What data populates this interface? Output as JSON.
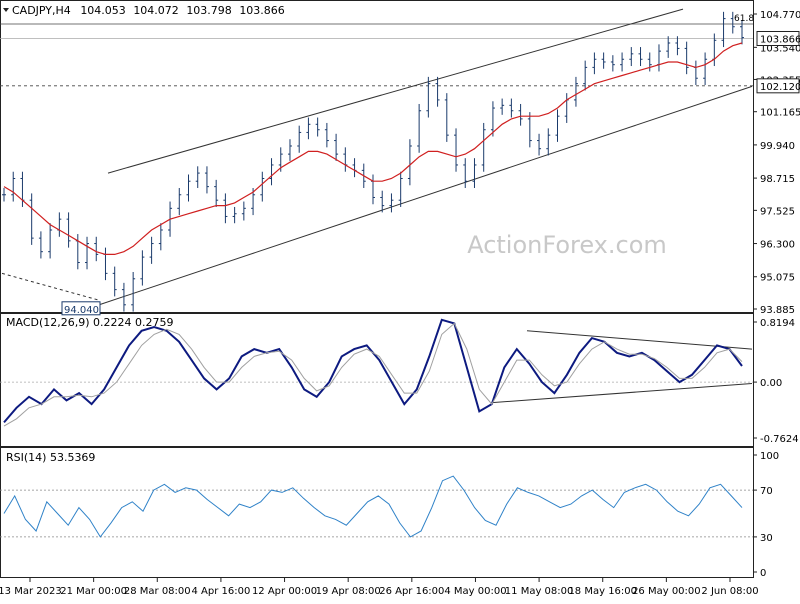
{
  "chart_data": [
    {
      "type": "line",
      "panel": "price",
      "header": {
        "symbol": "CADJPY,H4",
        "open": "104.053",
        "high": "104.072",
        "low": "103.798",
        "close": "103.866"
      },
      "watermark": "ActionForex.com",
      "y_ticks": [
        "104.770",
        "103.540",
        "102.355",
        "101.165",
        "99.940",
        "98.715",
        "97.525",
        "96.300",
        "95.075",
        "93.885"
      ],
      "ylim": [
        93.885,
        104.77
      ],
      "current_price_label": "103.866",
      "level_label": "102.120",
      "fib_label": "61.8",
      "low_annotation": "94.040",
      "series": [
        {
          "name": "price",
          "color": "#1a3a6b",
          "values": [
            98.1,
            98.7,
            97.9,
            96.5,
            96.0,
            96.8,
            97.2,
            96.4,
            95.6,
            96.3,
            95.9,
            95.2,
            94.6,
            94.04,
            95.0,
            95.8,
            96.3,
            96.8,
            97.6,
            98.1,
            98.6,
            98.9,
            98.4,
            97.9,
            97.3,
            97.4,
            97.6,
            98.1,
            98.7,
            99.2,
            99.6,
            99.9,
            100.4,
            100.7,
            100.5,
            100.1,
            99.6,
            99.2,
            99.0,
            98.6,
            98.0,
            97.7,
            97.9,
            98.7,
            99.9,
            101.2,
            102.2,
            101.6,
            100.3,
            99.2,
            98.6,
            99.2,
            100.5,
            101.3,
            101.4,
            101.2,
            100.9,
            100.1,
            99.8,
            100.3,
            101.0,
            101.6,
            102.2,
            102.8,
            103.1,
            103.0,
            102.9,
            103.1,
            103.3,
            103.1,
            102.9,
            103.4,
            103.7,
            103.5,
            102.8,
            102.4,
            103.1,
            103.8,
            104.6,
            104.3,
            103.9
          ]
        },
        {
          "name": "moving average",
          "color": "#d02020",
          "values": [
            98.4,
            98.2,
            97.9,
            97.6,
            97.3,
            97.0,
            96.8,
            96.6,
            96.4,
            96.2,
            96.0,
            95.9,
            95.9,
            96.0,
            96.2,
            96.5,
            96.8,
            97.0,
            97.2,
            97.3,
            97.4,
            97.5,
            97.6,
            97.7,
            97.7,
            97.8,
            98.0,
            98.2,
            98.5,
            98.8,
            99.1,
            99.3,
            99.5,
            99.7,
            99.7,
            99.6,
            99.4,
            99.2,
            99.0,
            98.8,
            98.6,
            98.6,
            98.7,
            98.9,
            99.2,
            99.5,
            99.7,
            99.7,
            99.6,
            99.5,
            99.6,
            99.8,
            100.1,
            100.4,
            100.7,
            100.9,
            101.0,
            101.0,
            101.0,
            101.1,
            101.3,
            101.6,
            101.8,
            102.0,
            102.2,
            102.3,
            102.4,
            102.5,
            102.6,
            102.7,
            102.8,
            102.9,
            103.0,
            103.0,
            102.9,
            102.8,
            102.9,
            103.1,
            103.4,
            103.6,
            103.7
          ]
        }
      ]
    },
    {
      "type": "line",
      "panel": "macd",
      "title": "MACD(12,26,9) 0.2224 0.2759",
      "y_ticks": [
        "0.8194",
        "0.00",
        "-0.7624"
      ],
      "ylim": [
        -0.7624,
        0.8194
      ],
      "series": [
        {
          "name": "MACD",
          "color": "#0d1a80",
          "values": [
            -0.55,
            -0.35,
            -0.2,
            -0.3,
            -0.1,
            -0.25,
            -0.15,
            -0.3,
            -0.1,
            0.2,
            0.5,
            0.7,
            0.75,
            0.7,
            0.55,
            0.3,
            0.05,
            -0.1,
            0.05,
            0.35,
            0.45,
            0.4,
            0.45,
            0.2,
            -0.1,
            -0.2,
            0.0,
            0.35,
            0.45,
            0.5,
            0.3,
            0.0,
            -0.3,
            -0.1,
            0.35,
            0.85,
            0.8,
            0.2,
            -0.4,
            -0.3,
            0.2,
            0.45,
            0.25,
            0.0,
            -0.15,
            0.1,
            0.4,
            0.6,
            0.55,
            0.4,
            0.35,
            0.4,
            0.3,
            0.15,
            0.0,
            0.1,
            0.3,
            0.5,
            0.45,
            0.22
          ]
        },
        {
          "name": "Signal",
          "color": "#a0a0a0",
          "values": [
            -0.6,
            -0.5,
            -0.35,
            -0.3,
            -0.2,
            -0.2,
            -0.18,
            -0.2,
            -0.15,
            0.0,
            0.25,
            0.5,
            0.65,
            0.72,
            0.65,
            0.45,
            0.2,
            0.0,
            0.0,
            0.2,
            0.35,
            0.4,
            0.42,
            0.3,
            0.05,
            -0.12,
            -0.05,
            0.2,
            0.38,
            0.45,
            0.35,
            0.1,
            -0.15,
            -0.15,
            0.15,
            0.65,
            0.8,
            0.45,
            -0.1,
            -0.3,
            0.0,
            0.3,
            0.3,
            0.1,
            -0.05,
            0.0,
            0.25,
            0.45,
            0.55,
            0.45,
            0.38,
            0.38,
            0.32,
            0.2,
            0.05,
            0.05,
            0.2,
            0.4,
            0.45,
            0.28
          ]
        }
      ]
    },
    {
      "type": "line",
      "panel": "rsi",
      "title": "RSI(14) 53.5369",
      "y_ticks": [
        "100",
        "70",
        "30",
        "0"
      ],
      "ylim": [
        0,
        100
      ],
      "series": [
        {
          "name": "RSI",
          "color": "#2f82c8",
          "values": [
            50,
            65,
            45,
            35,
            60,
            50,
            40,
            55,
            45,
            30,
            42,
            55,
            60,
            52,
            70,
            75,
            68,
            72,
            70,
            62,
            55,
            48,
            58,
            55,
            60,
            70,
            68,
            72,
            63,
            55,
            48,
            45,
            40,
            50,
            60,
            65,
            58,
            42,
            30,
            35,
            55,
            78,
            82,
            70,
            55,
            44,
            40,
            58,
            72,
            68,
            65,
            60,
            55,
            58,
            65,
            70,
            62,
            55,
            68,
            72,
            75,
            70,
            60,
            52,
            48,
            58,
            72,
            75,
            65,
            55
          ]
        }
      ]
    }
  ],
  "x_ticks": [
    "13 Mar 2023",
    "21 Mar 00:00",
    "28 Mar 08:00",
    "4 Apr 16:00",
    "12 Apr 00:00",
    "19 Apr 08:00",
    "26 Apr 16:00",
    "4 May 00:00",
    "11 May 08:00",
    "18 May 16:00",
    "26 May 00:00",
    "2 Jun 08:00"
  ]
}
